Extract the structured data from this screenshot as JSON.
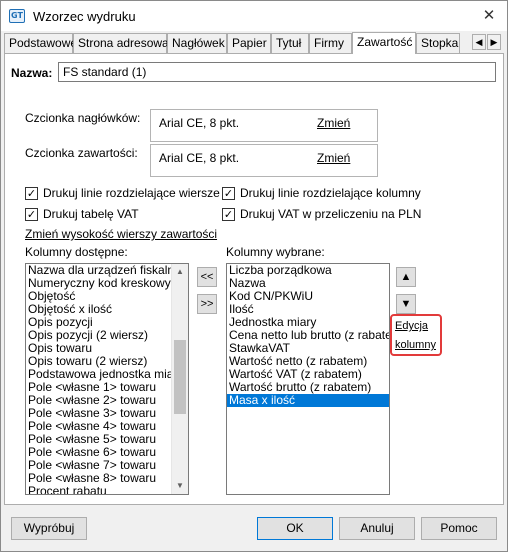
{
  "window": {
    "title": "Wzorzec wydruku",
    "app_icon_text": "GT"
  },
  "tabs": [
    {
      "label": "Podstawowe"
    },
    {
      "label": "Strona adresowa"
    },
    {
      "label": "Nagłówek"
    },
    {
      "label": "Papier"
    },
    {
      "label": "Tytuł"
    },
    {
      "label": "Firmy"
    },
    {
      "label": "Zawartość",
      "active": true
    },
    {
      "label": "Stopka"
    }
  ],
  "name_field": {
    "label": "Nazwa:",
    "value": "FS standard (1)"
  },
  "fonts": {
    "header": {
      "label": "Czcionka nagłówków:",
      "value": "Arial CE, 8 pkt.",
      "change": "Zmień"
    },
    "content": {
      "label": "Czcionka zawartości:",
      "value": "Arial CE, 8 pkt.",
      "change": "Zmień"
    }
  },
  "checkboxes": {
    "row_lines": {
      "label": "Drukuj linie rozdzielające wiersze",
      "checked": true
    },
    "col_lines": {
      "label": "Drukuj linie rozdzielające kolumny",
      "checked": true
    },
    "vat_table": {
      "label": "Drukuj tabelę VAT",
      "checked": true
    },
    "vat_conv": {
      "label": "Drukuj VAT w przeliczeniu na PLN",
      "checked": true
    }
  },
  "change_row_height": "Zmień wysokość wierszy zawartości",
  "available": {
    "label": "Kolumny dostępne:",
    "items": [
      "Nazwa dla urządzeń fiskalnych",
      "Numeryczny kod kreskowy",
      "Objętość",
      "Objętość x ilość",
      "Opis pozycji",
      "Opis pozycji (2 wiersz)",
      "Opis towaru",
      "Opis towaru (2 wiersz)",
      "Podstawowa jednostka miary",
      "Pole <własne 1> towaru",
      "Pole <własne 2> towaru",
      "Pole <własne 3> towaru",
      "Pole <własne 4> towaru",
      "Pole <własne 5> towaru",
      "Pole <własne 6> towaru",
      "Pole <własne 7> towaru",
      "Pole <własne 8> towaru",
      "Procent rabatu"
    ]
  },
  "selected": {
    "label": "Kolumny wybrane:",
    "items": [
      "Liczba porządkowa",
      "Nazwa",
      "Kod CN/PKWiU",
      "Ilość",
      "Jednostka miary",
      "Cena netto lub brutto (z rabatem)",
      "StawkaVAT",
      "Wartość netto (z rabatem)",
      "Wartość VAT (z rabatem)",
      "Wartość brutto (z rabatem)",
      "Masa x ilość"
    ],
    "selected_item": "Masa x ilość"
  },
  "transfer": {
    "remove": "<<",
    "add": ">>"
  },
  "edit_columns": {
    "line1": "Edycja",
    "line2": "kolumny"
  },
  "buttons": {
    "test": "Wypróbuj",
    "ok": "OK",
    "cancel": "Anuluj",
    "help": "Pomoc"
  },
  "colors": {
    "highlight": "#e23a3a",
    "selection": "#0078d7",
    "focus_border": "#0078d7"
  }
}
